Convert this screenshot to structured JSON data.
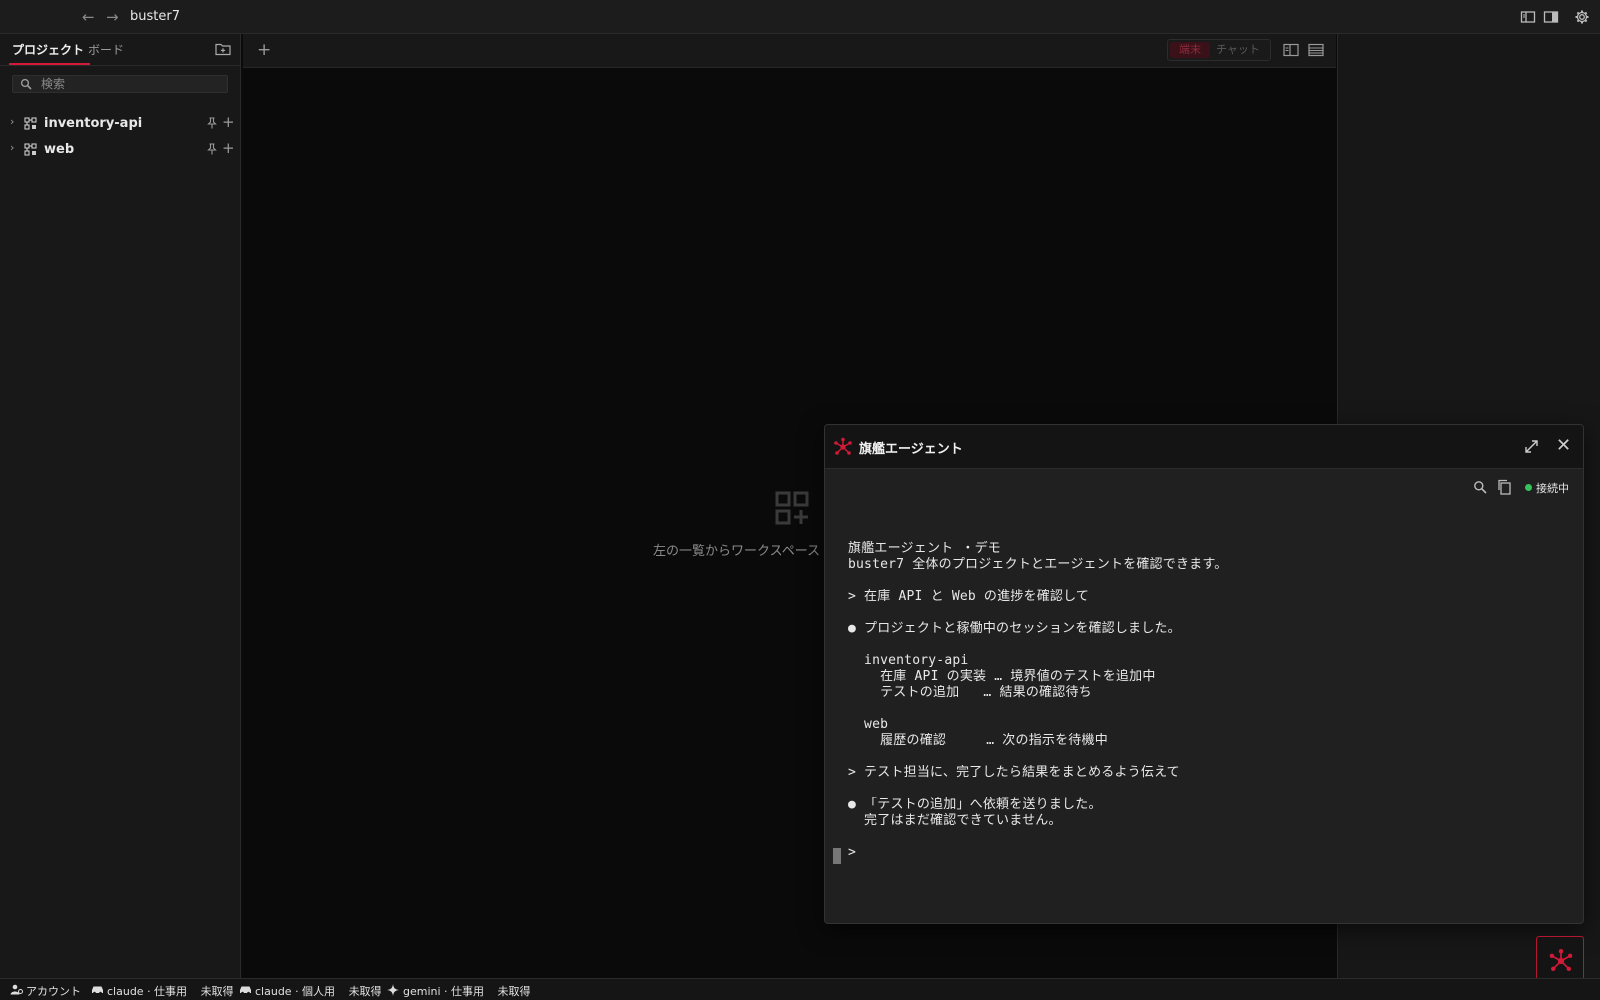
{
  "titlebar": {
    "title": "buster7",
    "back_label": "←",
    "forward_label": "→"
  },
  "sidebar": {
    "tabs": [
      {
        "label": "プロジェクト",
        "active": true
      },
      {
        "label": "ボード",
        "active": false
      }
    ],
    "search_placeholder": "検索",
    "projects": [
      {
        "name": "inventory-api"
      },
      {
        "name": "web"
      }
    ]
  },
  "workspace": {
    "add_label": "+",
    "mode_terminal": "端末",
    "mode_chat": "チャット",
    "empty_message": "左の一覧からワークスペース"
  },
  "agent": {
    "title": "旗艦エージェント",
    "close_label": "✕",
    "status": "接続中",
    "lines": [
      "",
      "旗艦エージェント ・デモ",
      "buster7 全体のプロジェクトとエージェントを確認できます。",
      "",
      "> 在庫 API と Web の進捗を確認して",
      "",
      "● プロジェクトと稼働中のセッションを確認しました。",
      "",
      "  inventory-api",
      "    在庫 API の実装 … 境界値のテストを追加中",
      "    テストの追加   … 結果の確認待ち",
      "",
      "  web",
      "    履歴の確認     … 次の指示を待機中",
      "",
      "> テスト担当に、完了したら結果をまとめるよう伝えて",
      "",
      "● 「テストの追加」へ依頼を送りました。",
      "  完了はまだ確認できていません。",
      "",
      ">"
    ]
  },
  "statusbar": {
    "items": [
      {
        "label": "アカウント",
        "value": "",
        "icon": "account-icon"
      },
      {
        "label": "claude · 仕事用",
        "value": "未取得",
        "icon": "car-icon"
      },
      {
        "label": "claude · 個人用",
        "value": "未取得",
        "icon": "car-icon"
      },
      {
        "label": "gemini · 仕事用",
        "value": "未取得",
        "icon": "sparkle-icon"
      }
    ]
  },
  "colors": {
    "accent": "#d11a38",
    "status_connected": "#37c15a",
    "background": "#0b0b0b",
    "panel": "#202020"
  }
}
